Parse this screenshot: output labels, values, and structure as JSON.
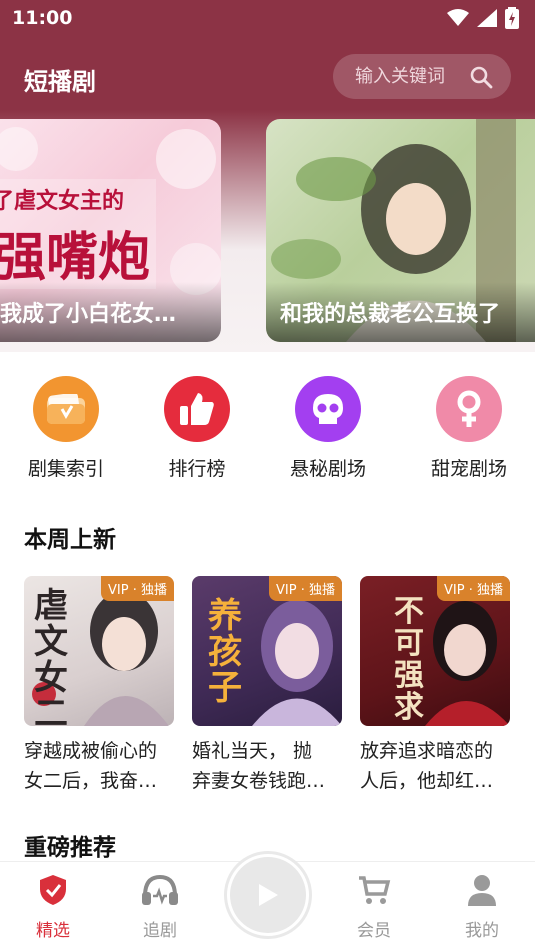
{
  "status": {
    "time": "11:00"
  },
  "header": {
    "title": "短播剧",
    "search_placeholder": "输入关键词"
  },
  "banners": [
    {
      "caption": "我成了小白花女…",
      "art_text_top": "了虐文女主的",
      "art_text_big": "强嘴炮"
    },
    {
      "caption": "和我的总裁老公互换了"
    }
  ],
  "categories": [
    {
      "label": "剧集索引",
      "icon": "folder-icon",
      "color": "#f0952e"
    },
    {
      "label": "排行榜",
      "icon": "thumbs-up-icon",
      "color": "#e52c3d"
    },
    {
      "label": "悬秘剧场",
      "icon": "skull-icon",
      "color": "#a43df0"
    },
    {
      "label": "甜宠剧场",
      "icon": "female-icon",
      "color": "#f08aa8"
    }
  ],
  "sections": {
    "weekly_new": "本周上新",
    "recommended": "重磅推荐"
  },
  "cards": [
    {
      "tag": "VIP · 独播",
      "cover_text": "虐文女二",
      "name_line1": "穿越成被偷心的",
      "name_line2": "女二后，我奋…"
    },
    {
      "tag": "VIP · 独播",
      "cover_text": "养孩子",
      "name_line1": "婚礼当天， 抛",
      "name_line2": "弃妻女卷钱跑…"
    },
    {
      "tag": "VIP · 独播",
      "cover_text": "不可强求",
      "name_line1": "放弃追求暗恋的",
      "name_line2": "人后，他却红…"
    }
  ],
  "nav": [
    {
      "label": "精选",
      "icon": "shield-check-icon",
      "active": true
    },
    {
      "label": "追剧",
      "icon": "headphones-icon",
      "active": false
    },
    {
      "label": "会员",
      "icon": "cart-icon",
      "active": false
    },
    {
      "label": "我的",
      "icon": "user-icon",
      "active": false
    }
  ]
}
